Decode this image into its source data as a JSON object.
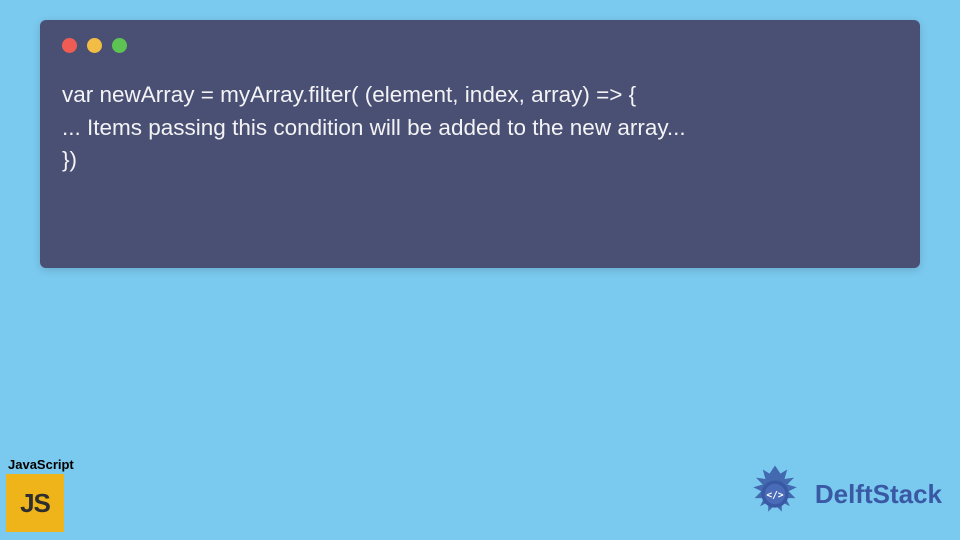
{
  "code": {
    "lines": [
      "var newArray = myArray.filter( (element, index, array) => {",
      "... Items passing this condition will be added to the new array...",
      "})"
    ]
  },
  "window": {
    "controls": [
      "close",
      "minimize",
      "maximize"
    ]
  },
  "badges": {
    "js": {
      "label": "JavaScript",
      "logo_text": "JS"
    },
    "delft": {
      "text": "DelftStack"
    }
  },
  "colors": {
    "background": "#7ac9ee",
    "window_bg": "#4a5074",
    "code_text": "#f3f3f5",
    "dot_red": "#ee5c54",
    "dot_yellow": "#f1bd44",
    "dot_green": "#5dc353",
    "js_bg": "#f0b41b",
    "delft_blue": "#3959a5"
  }
}
